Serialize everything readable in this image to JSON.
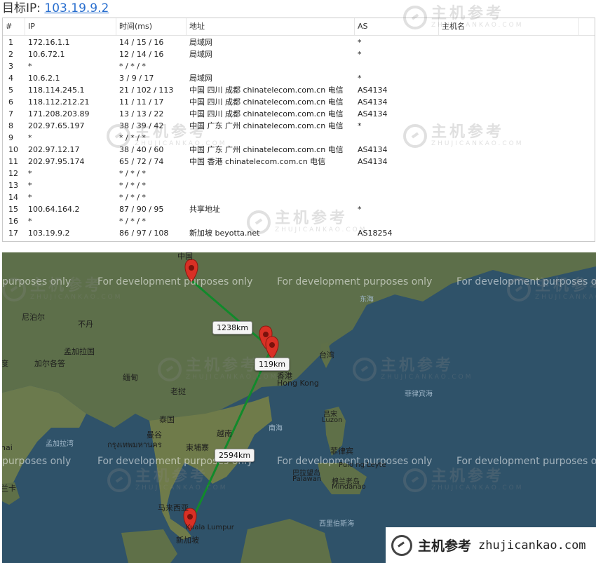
{
  "header": {
    "label": "目标IP:",
    "ip": "103.19.9.2"
  },
  "table": {
    "columns": [
      "#",
      "IP",
      "时间(ms)",
      "地址",
      "AS",
      "主机名"
    ],
    "rows": [
      {
        "n": "1",
        "ip": "172.16.1.1",
        "time": "14 / 15 / 16",
        "addr": "局域网",
        "as": "*"
      },
      {
        "n": "2",
        "ip": "10.6.72.1",
        "time": "12 / 14 / 16",
        "addr": "局域网",
        "as": "*"
      },
      {
        "n": "3",
        "ip": "*",
        "time": "* / * / *",
        "addr": "",
        "as": ""
      },
      {
        "n": "4",
        "ip": "10.6.2.1",
        "time": "3 / 9 / 17",
        "addr": "局域网",
        "as": "*"
      },
      {
        "n": "5",
        "ip": "118.114.245.1",
        "time": "21 / 102 / 113",
        "addr": "中国 四川 成都 chinatelecom.com.cn 电信",
        "as": "AS4134"
      },
      {
        "n": "6",
        "ip": "118.112.212.21",
        "time": "11 / 11 / 17",
        "addr": "中国 四川 成都 chinatelecom.com.cn 电信",
        "as": "AS4134"
      },
      {
        "n": "7",
        "ip": "171.208.203.89",
        "time": "13 / 13 / 22",
        "addr": "中国 四川 成都 chinatelecom.com.cn 电信",
        "as": "AS4134"
      },
      {
        "n": "8",
        "ip": "202.97.65.197",
        "time": "38 / 39 / 42",
        "addr": "中国 广东 广州 chinatelecom.com.cn 电信",
        "as": "*"
      },
      {
        "n": "9",
        "ip": "*",
        "time": "* / * / *",
        "addr": "",
        "as": ""
      },
      {
        "n": "10",
        "ip": "202.97.12.17",
        "time": "38 / 40 / 60",
        "addr": "中国 广东 广州 chinatelecom.com.cn 电信",
        "as": "AS4134"
      },
      {
        "n": "11",
        "ip": "202.97.95.174",
        "time": "65 / 72 / 74",
        "addr": "中国 香港 chinatelecom.com.cn 电信",
        "as": "AS4134"
      },
      {
        "n": "12",
        "ip": "*",
        "time": "* / * / *",
        "addr": "",
        "as": ""
      },
      {
        "n": "13",
        "ip": "*",
        "time": "* / * / *",
        "addr": "",
        "as": ""
      },
      {
        "n": "14",
        "ip": "*",
        "time": "* / * / *",
        "addr": "",
        "as": ""
      },
      {
        "n": "15",
        "ip": "100.64.164.2",
        "time": "87 / 90 / 95",
        "addr": "共享地址",
        "as": "*"
      },
      {
        "n": "16",
        "ip": "*",
        "time": "* / * / *",
        "addr": "",
        "as": ""
      },
      {
        "n": "17",
        "ip": "103.19.9.2",
        "time": "86 / 97 / 108",
        "addr": "新加坡 beyotta.net",
        "as": "AS18254"
      }
    ]
  },
  "watermark": {
    "name": "主机参考",
    "domain": "ZHUJICANKAO.COM"
  },
  "map": {
    "dev_text": "For development purposes only",
    "dev_text_cut_left": "purposes only",
    "dev_text_cut_right": "For development purposes on",
    "distances": [
      "1238km",
      "119km",
      "2594km"
    ],
    "labels": {
      "china": "中国",
      "nepal": "尼泊尔",
      "bhutan": "不丹",
      "bangladesh": "孟加拉国",
      "kolkata": "加尔各答",
      "india_cut": "度",
      "myanmar": "缅甸",
      "laos": "老挝",
      "thailand": "泰国",
      "bangkok": "曼谷",
      "bangkok_th": "กรุงเทพมหานคร",
      "cambodia": "柬埔寨",
      "vietnam": "越南",
      "malaysia": "马来西亚",
      "kl": "Kuala Lumpur",
      "singapore": "新加坡",
      "srilanka": "兰卡",
      "chennai_cut": "nai",
      "bay_of_bengal": "孟加拉湾",
      "taiwan": "台湾",
      "hk_cn": "香港",
      "hk_en": "Hong Kong",
      "east_sea": "东海",
      "south_sea": "南海",
      "philippine_sea": "菲律宾海",
      "philippines": "菲律宾",
      "pulong": "Pulo ng Leyte",
      "luzon_cn": "吕宋",
      "luzon": "Luzon",
      "palawan_cn": "巴拉望岛",
      "palawan": "Palawan",
      "mindanao_cn": "棉兰老岛",
      "mindanao": "Mindanao",
      "sulawesi_sea": "西里伯斯海"
    }
  },
  "brand": {
    "name": "主机参考",
    "domain": "zhujicankao.com"
  }
}
